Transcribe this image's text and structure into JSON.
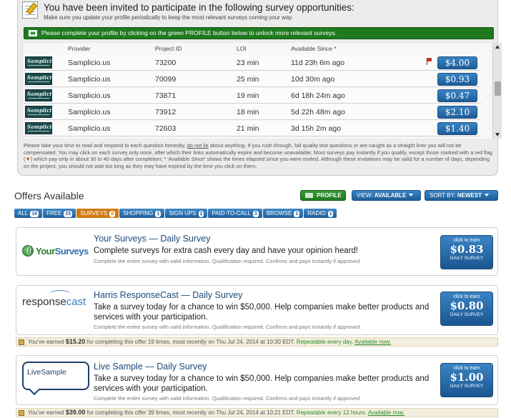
{
  "invite": {
    "title": "You have been invited to participate in the following survey opportunities:",
    "subtitle": "Make sure you update your profile periodically to keep the most relevant surveys coming your way.",
    "profile_notice": "Please complete your profile by clicking on the green PROFILE button below to unlock more relevant surveys.",
    "columns": {
      "provider": "Provider",
      "project_id": "Project ID",
      "loi": "LOI",
      "available_since": "Available Since *"
    },
    "rows": [
      {
        "logo": "Samplicio.us",
        "provider": "Samplicio.us",
        "project_id": "73200",
        "loi": "23 min",
        "since": "11d 23h 6m ago",
        "price": "$4.00",
        "red_flag": true
      },
      {
        "logo": "Samplicio.us",
        "provider": "Samplicio.us",
        "project_id": "70099",
        "loi": "25 min",
        "since": "10d 30m ago",
        "price": "$0.93",
        "red_flag": false
      },
      {
        "logo": "Samplicio.us",
        "provider": "Samplicio.us",
        "project_id": "73871",
        "loi": "19 min",
        "since": "6d 18h 24m ago",
        "price": "$0.47",
        "red_flag": false
      },
      {
        "logo": "Samplicio.us",
        "provider": "Samplicio.us",
        "project_id": "73912",
        "loi": "18 min",
        "since": "5d 22h 48m ago",
        "price": "$2.10",
        "red_flag": false
      },
      {
        "logo": "Samplicio.us",
        "provider": "Samplicio.us",
        "project_id": "72603",
        "loi": "21 min",
        "since": "3d 15h 2m ago",
        "price": "$1.40",
        "red_flag": false
      }
    ],
    "disclaimer_a": "Please take your time to read and respond to each question honestly, ",
    "disclaimer_u": "do not lie",
    "disclaimer_b": " about anything. If you rush through, fail quality test questions or are caught as a straight liner you will not be compensated; You may click on each survey only once, after which their links automatically expire and become unavailable; Most surveys pay instantly if you qualify, except those marked with a red flag (",
    "disclaimer_c": ") which pay only in about 30 to 40 days after completion; * 'Available Since' shows the times elapsed since you were invited. Although these invitations may be valid for a number of days, depending on the project, you should not wait too long as they may have expired by the time you click on them."
  },
  "offers": {
    "title": "Offers Available",
    "profile_button": "PROFILE",
    "view_label": "VIEW:",
    "view_value": "AVAILABLE",
    "sort_label": "SORT BY:",
    "sort_value": "NEWEST",
    "tabs": [
      {
        "label": "ALL",
        "count": "16",
        "active": false
      },
      {
        "label": "FREE",
        "count": "15",
        "active": false
      },
      {
        "label": "SURVEYS",
        "count": "8",
        "active": true
      },
      {
        "label": "SHOPPING",
        "count": "1",
        "active": false
      },
      {
        "label": "SIGN UPS",
        "count": "2",
        "active": false
      },
      {
        "label": "PAID-TO-CALL",
        "count": "3",
        "active": false
      },
      {
        "label": "BROWSE",
        "count": "1",
        "active": false
      },
      {
        "label": "RADIO",
        "count": "1",
        "active": false
      }
    ],
    "items": [
      {
        "logo_a": "Your",
        "logo_b": "Surveys",
        "name": "Your Surveys — Daily Survey",
        "description": "Complete surveys for extra cash every day and have your opinion heard!",
        "requirements": "Complete the entire survey with valid information. Qualification required. Confirms and pays instantly if approved.",
        "cta_top": "click to earn",
        "amount": "$0.83",
        "cta_bottom": "DAILY SURVEY"
      },
      {
        "logo_a": "response",
        "logo_b": "cast",
        "name": "Harris ResponseCast — Daily Survey",
        "description": "Take a survey today for a chance to win $50,000. Help companies make better products and services with your participation.",
        "requirements": "Complete the entire survey with valid information. Qualification required. Confirms and pays instantly if approved.",
        "cta_top": "click to earn",
        "amount": "$0.80",
        "cta_bottom": "DAILY SURVEY",
        "earned_prefix": "You've earned ",
        "earned_amount": "$15.20",
        "earned_text": " for completing this offer 19 times, most recently on Thu Jul 24, 2014 at 10:30 EDT. ",
        "repeat_text": "Repeatable every day.",
        "available_text": "Available now."
      },
      {
        "logo_a": "LiveSample",
        "logo_b": "",
        "name": "Live Sample — Daily Survey",
        "description": "Take a survey today for a chance to win $50,000. Help companies make better products and services with your participation.",
        "requirements": "Complete the entire survey with valid information. Qualification required. Confirms and pays instantly if approved.",
        "cta_top": "click to earn",
        "amount": "$1.00",
        "cta_bottom": "DAILY SURVEY",
        "earned_prefix": "You've earned ",
        "earned_amount": "$39.00",
        "earned_text": " for completing this offer 39 times, most recently on Thu Jul 24, 2014 at 10:21 EDT. ",
        "repeat_text": "Repeatable every 12 hours.",
        "available_text": "Available now."
      }
    ]
  },
  "colors": {
    "accent_blue": "#1e5d98",
    "profile_green": "#1f7a1f",
    "active_tab": "#cf7a12"
  }
}
